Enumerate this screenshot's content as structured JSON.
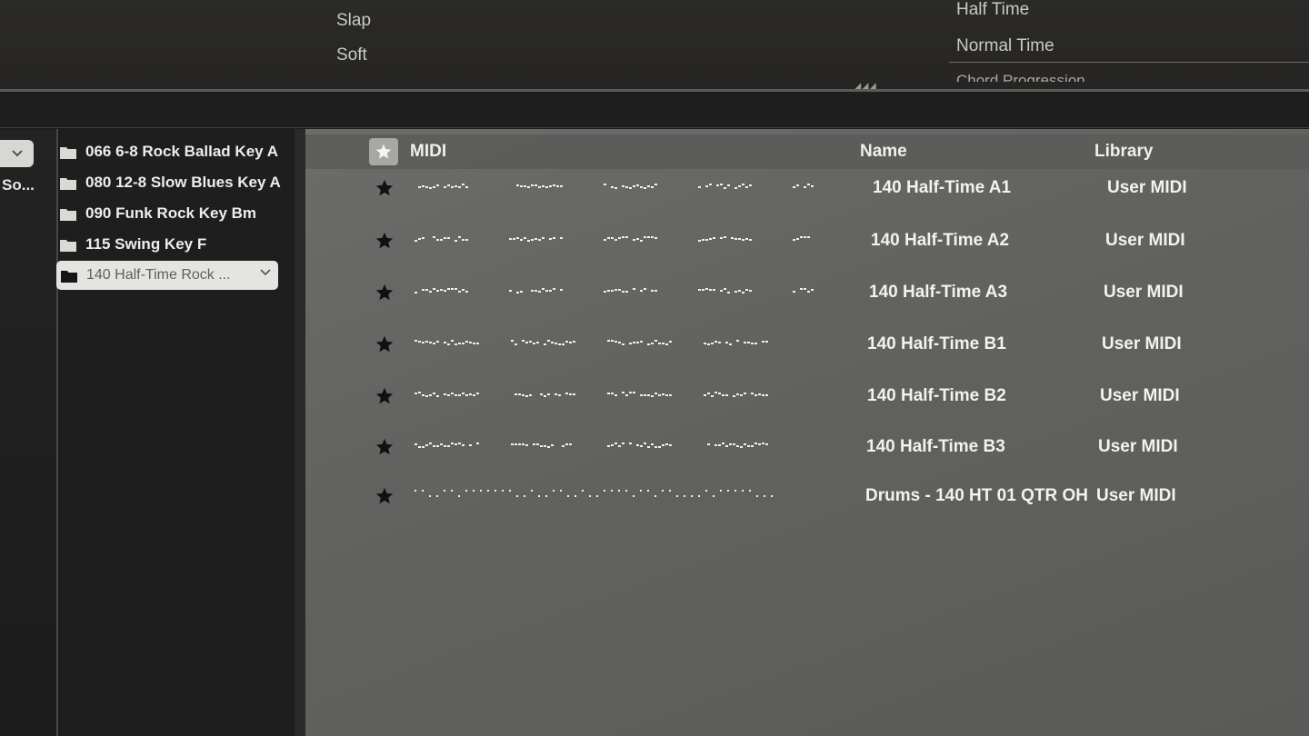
{
  "top": {
    "left_tags": [
      "Slap",
      "Soft"
    ],
    "right_tags": [
      "Half Time",
      "Normal Time"
    ],
    "right_cut_tag": "Chord Progression"
  },
  "left_column": {
    "label": "So..."
  },
  "folders": [
    {
      "label": "066 6-8 Rock Ballad Key A"
    },
    {
      "label": "080 12-8 Slow Blues Key A"
    },
    {
      "label": "090 Funk Rock Key Bm"
    },
    {
      "label": "115 Swing Key F"
    }
  ],
  "selected_folder": {
    "label": "140 Half-Time Rock ..."
  },
  "browser": {
    "columns": {
      "midi": "MIDI",
      "name": "Name",
      "library": "Library"
    },
    "rows": [
      {
        "name": "140 Half-Time A1",
        "library": "User MIDI"
      },
      {
        "name": "140 Half-Time A2",
        "library": "User MIDI"
      },
      {
        "name": "140 Half-Time A3",
        "library": "User MIDI"
      },
      {
        "name": "140 Half-Time B1",
        "library": "User MIDI"
      },
      {
        "name": "140 Half-Time B2",
        "library": "User MIDI"
      },
      {
        "name": "140 Half-Time B3",
        "library": "User MIDI"
      },
      {
        "name": "Drums - 140 HT 01 QTR OH",
        "library": "User MIDI"
      }
    ]
  },
  "colors": {
    "accent_light": "#e4e4e1",
    "pane_bg": "#646462",
    "text": "#f2f2ef"
  },
  "icons": {
    "favorite": "star-icon",
    "folder": "folder-icon",
    "dropdown": "chevron-down-icon"
  }
}
